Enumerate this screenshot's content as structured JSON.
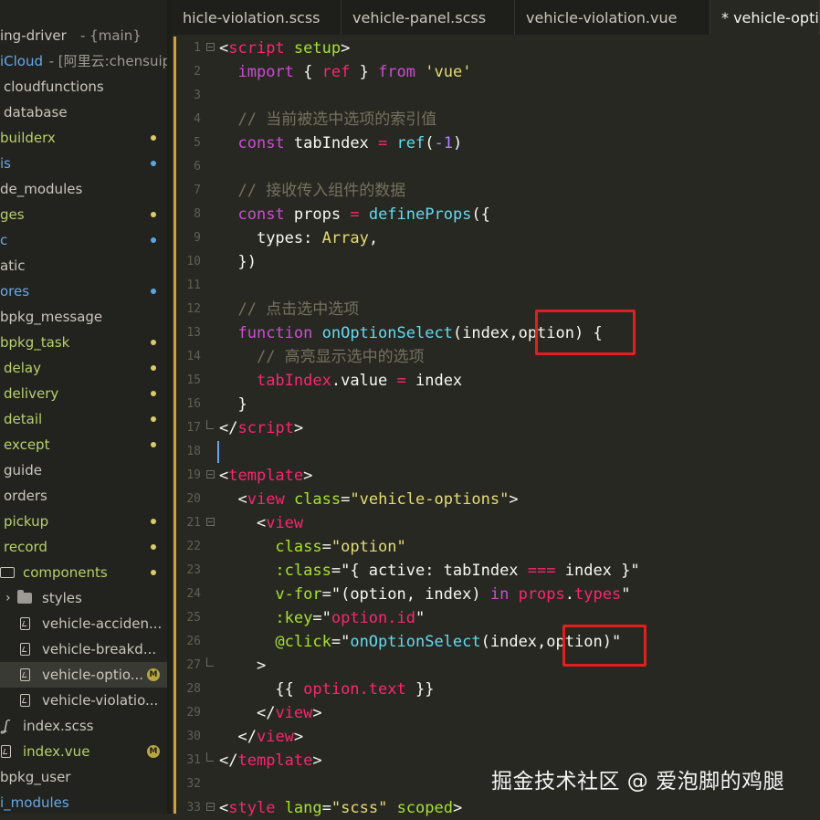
{
  "sidebar": {
    "items": [
      {
        "label": "ing-driver",
        "suffix": " - {main}",
        "indent": 0,
        "style": "plain"
      },
      {
        "label": "iCloud",
        "suffix": " - [阿里云:chensuip",
        "indent": 0,
        "style": "blue"
      },
      {
        "label": "cloudfunctions",
        "indent": 4,
        "style": "plain"
      },
      {
        "label": "database",
        "indent": 4,
        "style": "plain"
      },
      {
        "label": "builderx",
        "indent": 0,
        "style": "green",
        "dot": "yellow"
      },
      {
        "label": "is",
        "indent": 0,
        "style": "blue",
        "dot": "blue"
      },
      {
        "label": "de_modules",
        "indent": 0,
        "style": "plain"
      },
      {
        "label": "ges",
        "indent": 0,
        "style": "green",
        "dot": "yellow"
      },
      {
        "label": "c",
        "indent": 0,
        "style": "blue",
        "dot": "blue"
      },
      {
        "label": "atic",
        "indent": 0,
        "style": "plain"
      },
      {
        "label": "ores",
        "indent": 0,
        "style": "blue",
        "dot": "blue"
      },
      {
        "label": "bpkg_message",
        "indent": 0,
        "style": "plain"
      },
      {
        "label": "bpkg_task",
        "indent": 0,
        "style": "green",
        "dot": "yellow"
      },
      {
        "label": "delay",
        "indent": 4,
        "style": "green",
        "dot": "yellow"
      },
      {
        "label": "delivery",
        "indent": 4,
        "style": "green",
        "dot": "yellow"
      },
      {
        "label": "detail",
        "indent": 4,
        "style": "green",
        "dot": "yellow"
      },
      {
        "label": "except",
        "indent": 4,
        "style": "green",
        "dot": "yellow"
      },
      {
        "label": "guide",
        "indent": 4,
        "style": "plain"
      },
      {
        "label": "orders",
        "indent": 4,
        "style": "plain"
      },
      {
        "label": "pickup",
        "indent": 4,
        "style": "green",
        "dot": "yellow"
      },
      {
        "label": "record",
        "indent": 4,
        "style": "green",
        "dot": "yellow"
      },
      {
        "label": "components",
        "indent": 25,
        "style": "green",
        "dot": "yellow",
        "icon": "folder-open-icon"
      },
      {
        "label": "styles",
        "indent": 46,
        "style": "plain",
        "icon": "folder-icon",
        "chevron": "›"
      },
      {
        "label": "vehicle-acciden...",
        "indent": 46,
        "style": "plain",
        "icon": "file-vue-icon"
      },
      {
        "label": "vehicle-breakd...",
        "indent": 46,
        "style": "plain",
        "icon": "file-vue-icon"
      },
      {
        "label": "vehicle-optio...",
        "indent": 46,
        "style": "plain",
        "icon": "file-vue-icon",
        "badge": "M",
        "selected": true
      },
      {
        "label": "vehicle-violatio...",
        "indent": 46,
        "style": "plain",
        "icon": "file-vue-icon"
      },
      {
        "label": "index.scss",
        "indent": 25,
        "style": "plain",
        "icon": "scss-icon"
      },
      {
        "label": "index.vue",
        "indent": 25,
        "style": "green",
        "icon": "file-vue-icon",
        "badge": "M"
      },
      {
        "label": "bpkg_user",
        "indent": 0,
        "style": "plain"
      },
      {
        "label": "i_modules",
        "indent": 0,
        "style": "blue"
      }
    ]
  },
  "tabs": [
    {
      "label": "hicle-violation.scss",
      "active": false
    },
    {
      "label": "vehicle-panel.scss",
      "active": false
    },
    {
      "label": "vehicle-violation.vue",
      "active": false
    },
    {
      "label": "* vehicle-opti",
      "active": true
    }
  ],
  "editor": {
    "lines": [
      {
        "n": "1",
        "fold": "open",
        "tokens": [
          [
            "<",
            "p"
          ],
          [
            "script",
            "t"
          ],
          [
            " ",
            "w"
          ],
          [
            "setup",
            "a"
          ],
          [
            ">",
            "p"
          ]
        ]
      },
      {
        "n": "2",
        "tokens": [
          [
            "  ",
            "w"
          ],
          [
            "import",
            "k"
          ],
          [
            " { ",
            "w"
          ],
          [
            "ref",
            "v"
          ],
          [
            " } ",
            "w"
          ],
          [
            "from",
            "k"
          ],
          [
            " ",
            "w"
          ],
          [
            "'vue'",
            "s"
          ]
        ]
      },
      {
        "n": "3",
        "tokens": []
      },
      {
        "n": "4",
        "tokens": [
          [
            "  ",
            "w"
          ],
          [
            "// 当前被选中选项的索引值",
            "c"
          ]
        ]
      },
      {
        "n": "5",
        "tokens": [
          [
            "  ",
            "w"
          ],
          [
            "const",
            "k"
          ],
          [
            " tabIndex ",
            "w"
          ],
          [
            "=",
            "o"
          ],
          [
            " ",
            "w"
          ],
          [
            "ref",
            "f"
          ],
          [
            "(",
            "w"
          ],
          [
            "-1",
            "n"
          ],
          [
            ")",
            "w"
          ]
        ]
      },
      {
        "n": "6",
        "tokens": []
      },
      {
        "n": "7",
        "tokens": [
          [
            "  ",
            "w"
          ],
          [
            "// 接收传入组件的数据",
            "c"
          ]
        ]
      },
      {
        "n": "8",
        "tokens": [
          [
            "  ",
            "w"
          ],
          [
            "const",
            "k"
          ],
          [
            " props ",
            "w"
          ],
          [
            "=",
            "o"
          ],
          [
            " ",
            "w"
          ],
          [
            "defineProps",
            "f"
          ],
          [
            "({",
            "w"
          ]
        ]
      },
      {
        "n": "9",
        "tokens": [
          [
            "    ",
            "w"
          ],
          [
            "types",
            "w"
          ],
          [
            ": ",
            "w"
          ],
          [
            "Array",
            "y"
          ],
          [
            ",",
            "w"
          ]
        ]
      },
      {
        "n": "10",
        "tokens": [
          [
            "  })",
            "w"
          ]
        ]
      },
      {
        "n": "11",
        "tokens": []
      },
      {
        "n": "12",
        "tokens": [
          [
            "  ",
            "w"
          ],
          [
            "// 点击选中选项",
            "c"
          ]
        ]
      },
      {
        "n": "13",
        "tokens": [
          [
            "  ",
            "w"
          ],
          [
            "function",
            "k"
          ],
          [
            " ",
            "w"
          ],
          [
            "onOptionSelect",
            "f"
          ],
          [
            "(index,",
            "w"
          ],
          [
            "option",
            "w"
          ],
          [
            ") {",
            "w"
          ]
        ]
      },
      {
        "n": "14",
        "tokens": [
          [
            "    ",
            "w"
          ],
          [
            "// 高亮显示选中的选项",
            "c"
          ]
        ]
      },
      {
        "n": "15",
        "tokens": [
          [
            "    ",
            "w"
          ],
          [
            "tabIndex",
            "v"
          ],
          [
            ".value ",
            "w"
          ],
          [
            "=",
            "o"
          ],
          [
            " index",
            "w"
          ]
        ]
      },
      {
        "n": "16",
        "tokens": [
          [
            "  }",
            "w"
          ]
        ]
      },
      {
        "n": "17",
        "fold": "end",
        "tokens": [
          [
            "</",
            "p"
          ],
          [
            "script",
            "t"
          ],
          [
            ">",
            "p"
          ]
        ]
      },
      {
        "n": "18",
        "cursor": true,
        "tokens": []
      },
      {
        "n": "19",
        "fold": "open",
        "tokens": [
          [
            "<",
            "p"
          ],
          [
            "template",
            "t"
          ],
          [
            ">",
            "p"
          ]
        ]
      },
      {
        "n": "20",
        "tokens": [
          [
            "  ",
            "w"
          ],
          [
            "<",
            "p"
          ],
          [
            "view",
            "t"
          ],
          [
            " ",
            "w"
          ],
          [
            "class",
            "a"
          ],
          [
            "=",
            "w"
          ],
          [
            "\"vehicle-options\"",
            "s"
          ],
          [
            ">",
            "p"
          ]
        ]
      },
      {
        "n": "21",
        "fold": "open",
        "tokens": [
          [
            "    ",
            "w"
          ],
          [
            "<",
            "p"
          ],
          [
            "view",
            "t"
          ]
        ]
      },
      {
        "n": "22",
        "tokens": [
          [
            "      ",
            "w"
          ],
          [
            "class",
            "a"
          ],
          [
            "=",
            "w"
          ],
          [
            "\"option\"",
            "s"
          ]
        ]
      },
      {
        "n": "23",
        "tokens": [
          [
            "      ",
            "w"
          ],
          [
            ":class",
            "a"
          ],
          [
            "=\"{ active: tabIndex ",
            "w"
          ],
          [
            "===",
            "o"
          ],
          [
            " index }\"",
            "w"
          ]
        ]
      },
      {
        "n": "24",
        "tokens": [
          [
            "      ",
            "w"
          ],
          [
            "v-for",
            "a"
          ],
          [
            "=\"(option, index) ",
            "w"
          ],
          [
            "in",
            "k"
          ],
          [
            " ",
            "w"
          ],
          [
            "props",
            "v"
          ],
          [
            ".",
            "w"
          ],
          [
            "types",
            "v"
          ],
          [
            "\"",
            "w"
          ]
        ]
      },
      {
        "n": "25",
        "tokens": [
          [
            "      ",
            "w"
          ],
          [
            ":key",
            "a"
          ],
          [
            "=\"",
            "w"
          ],
          [
            "option.id",
            "v"
          ],
          [
            "\"",
            "w"
          ]
        ]
      },
      {
        "n": "26",
        "tokens": [
          [
            "      ",
            "w"
          ],
          [
            "@click",
            "a"
          ],
          [
            "=\"",
            "w"
          ],
          [
            "onOptionSelect",
            "f"
          ],
          [
            "(index,",
            "w"
          ],
          [
            "option",
            "w"
          ],
          [
            ")\"",
            "w"
          ]
        ]
      },
      {
        "n": "27",
        "fold": "end",
        "tokens": [
          [
            "    >",
            "w"
          ]
        ]
      },
      {
        "n": "28",
        "tokens": [
          [
            "      {{ ",
            "w"
          ],
          [
            "option.text",
            "v"
          ],
          [
            " }}",
            "w"
          ]
        ]
      },
      {
        "n": "29",
        "tokens": [
          [
            "    ",
            "w"
          ],
          [
            "</",
            "p"
          ],
          [
            "view",
            "t"
          ],
          [
            ">",
            "p"
          ]
        ]
      },
      {
        "n": "30",
        "tokens": [
          [
            "  ",
            "w"
          ],
          [
            "</",
            "p"
          ],
          [
            "view",
            "t"
          ],
          [
            ">",
            "p"
          ]
        ]
      },
      {
        "n": "31",
        "fold": "end",
        "tokens": [
          [
            "</",
            "p"
          ],
          [
            "template",
            "t"
          ],
          [
            ">",
            "p"
          ]
        ]
      },
      {
        "n": "32",
        "tokens": []
      },
      {
        "n": "33",
        "fold": "open",
        "tokens": [
          [
            "<",
            "p"
          ],
          [
            "style",
            "t"
          ],
          [
            " ",
            "w"
          ],
          [
            "lang",
            "a"
          ],
          [
            "=",
            "w"
          ],
          [
            "\"scss\"",
            "s"
          ],
          [
            " ",
            "w"
          ],
          [
            "scoped",
            "a"
          ],
          [
            ">",
            "p"
          ]
        ]
      }
    ]
  },
  "colors": {
    "w": "#f8f8f2",
    "p": "#f8f8f2",
    "t": "#f92672",
    "a": "#a6e22e",
    "k": "#d04ad6",
    "v": "#f92672",
    "s": "#e6db74",
    "c": "#75715e",
    "f": "#66d9ef",
    "n": "#ae81ff",
    "o": "#f92672",
    "y": "#e6db74",
    "highlight_box": "#e02020",
    "modified_bar": "#d79f2e"
  },
  "watermark": "掘金技术社区 @ 爱泡脚的鸡腿"
}
